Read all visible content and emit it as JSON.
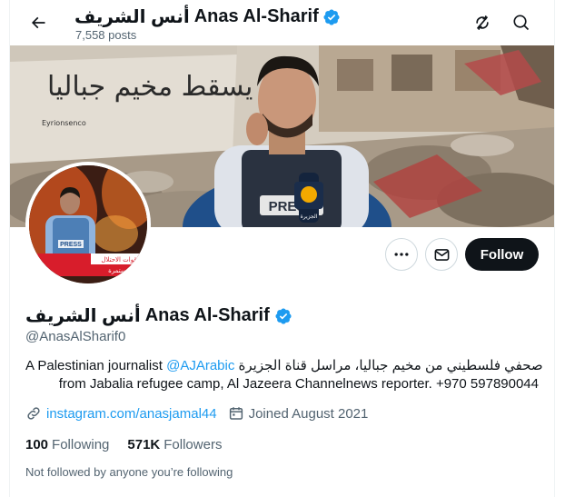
{
  "header": {
    "back_icon": "arrow-left-icon",
    "name_arabic": "أنس الشريف",
    "name_latin": "Anas Al-Sharif",
    "posts_count": "7,558 posts",
    "sync_icon": "circle-arrows-icon",
    "search_icon": "search-icon"
  },
  "banner": {
    "wall_text": "لن يسقط مخيم جباليا",
    "wall_signature": "Eyrionsenco",
    "vest_text": "PRESS",
    "mic_logo": "الجزيرة"
  },
  "avatar": {
    "vest_text": "PRESS",
    "lower_third": "قوات الاحتلال",
    "lower_third_2": "مستمرة"
  },
  "actions": {
    "more_icon": "ellipsis-icon",
    "message_icon": "envelope-icon",
    "follow_label": "Follow"
  },
  "profile": {
    "name_arabic": "أنس الشريف",
    "name_latin": "Anas Al-Sharif",
    "handle": "@AnasAlSharif0",
    "bio_line1_prefix": "A Palestinian journalist ",
    "bio_mention": "@AJArabic",
    "bio_line1_suffix": " صحفي فلسطيني من مخيم جباليا، مراسل قناة الجزيرة",
    "bio_line2": "from Jabalia refugee camp, Al Jazeera Channelnews reporter. +970 597890044",
    "link_icon": "link-icon",
    "link_text": "instagram.com/anasjamal44",
    "calendar_icon": "calendar-icon",
    "joined_text": "Joined August 2021",
    "following_count": "100",
    "following_label": "Following",
    "followers_count": "571K",
    "followers_label": "Followers",
    "not_followed_text": "Not followed by anyone you’re following"
  },
  "colors": {
    "accent": "#1d9bf0",
    "text_primary": "#0f1419",
    "text_secondary": "#536471",
    "follow_bg": "#0f1419",
    "verified": "#1d9bf0"
  }
}
